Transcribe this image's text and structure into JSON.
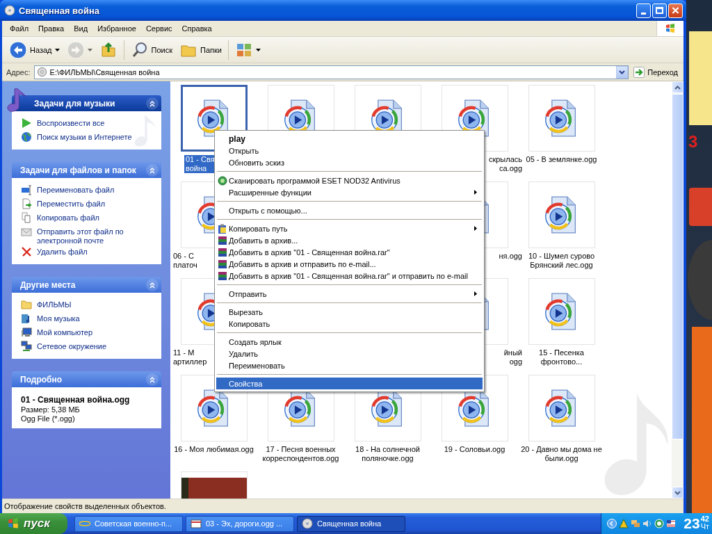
{
  "window": {
    "title": "Священная война"
  },
  "menu_bar": [
    "Файл",
    "Правка",
    "Вид",
    "Избранное",
    "Сервис",
    "Справка"
  ],
  "toolbar": [
    {
      "kind": "back",
      "label": "Назад",
      "disabled": false
    },
    {
      "kind": "forward",
      "disabled": true
    },
    {
      "kind": "up",
      "disabled": false
    },
    {
      "kind": "search",
      "label": "Поиск",
      "disabled": false
    },
    {
      "kind": "folders",
      "label": "Папки",
      "disabled": false
    },
    {
      "kind": "views",
      "disabled": false
    }
  ],
  "address": {
    "label": "Адрес:",
    "value": "E:\\ФИЛЬМЫ\\Священная война",
    "go": "Переход"
  },
  "sidebar": {
    "sections": [
      {
        "kind": "music",
        "title": "Задачи для музыки",
        "items": [
          {
            "label": "Воспроизвести все"
          },
          {
            "label": "Поиск музыки в Интернете"
          }
        ]
      },
      {
        "kind": "tasks",
        "title": "Задачи для файлов и папок",
        "items": [
          {
            "label": "Переименовать файл"
          },
          {
            "label": "Переместить файл"
          },
          {
            "label": "Копировать файл"
          },
          {
            "label": "Отправить этот файл по электронной почте"
          },
          {
            "label": "Удалить файл"
          }
        ]
      },
      {
        "kind": "places",
        "title": "Другие места",
        "items": [
          {
            "label": "ФИЛЬМЫ"
          },
          {
            "label": "Моя музыка"
          },
          {
            "label": "Мой компьютер"
          },
          {
            "label": "Сетевое окружение"
          }
        ]
      },
      {
        "kind": "details",
        "title": "Подробно",
        "name": "01 - Священная война.ogg",
        "lines": [
          "Размер: 5,38 МБ",
          "Ogg File (*.ogg)"
        ]
      }
    ]
  },
  "files": [
    {
      "kind": "audio",
      "label": "01 - Свя\nвойна",
      "selected": true
    },
    {
      "kind": "audio",
      "selected": false
    },
    {
      "kind": "audio",
      "selected": false
    },
    {
      "kind": "audio",
      "label": "скрылась\nса.ogg",
      "selected": false
    },
    {
      "kind": "audio",
      "label": "05 - В землянке.ogg",
      "selected": false
    },
    {
      "kind": "audio",
      "label": "06 - С\nплаточ",
      "selected": false
    },
    {
      "kind": "audio",
      "label": "ня.ogg",
      "selected": false
    },
    {
      "kind": "audio",
      "label": "10 - Шумел сурово\nБрянский лес.ogg",
      "selected": false
    },
    {
      "kind": "audio",
      "label": "11 - М\nартиллер",
      "selected": false
    },
    {
      "kind": "audio",
      "label": "йный\nogg",
      "selected": false
    },
    {
      "kind": "audio",
      "label": "15 - Песенка\nфронтово...",
      "selected": false
    },
    {
      "kind": "audio",
      "label": "16 - Моя любимая.ogg",
      "selected": false
    },
    {
      "kind": "audio",
      "label": "17 - Песня военных\nкорреспондентов.ogg",
      "selected": false
    },
    {
      "kind": "audio",
      "label": "18 - На солнечной\nполяночке.ogg",
      "selected": false
    },
    {
      "kind": "audio",
      "label": "19 - Соловьи.ogg",
      "selected": false
    },
    {
      "kind": "audio",
      "label": "20 - Давно мы дома не\nбыли.ogg",
      "selected": false
    },
    {
      "kind": "image",
      "selected": false
    }
  ],
  "context_menu": {
    "groups": [
      [
        {
          "label": "play",
          "default": true,
          "submenu": false,
          "selected": false
        },
        {
          "label": "Открыть",
          "default": false,
          "submenu": false,
          "selected": false
        },
        {
          "label": "Обновить эскиз",
          "default": false,
          "submenu": false,
          "selected": false
        }
      ],
      [
        {
          "label": "Сканировать программой ESET NOD32 Antivirus",
          "default": false,
          "submenu": false,
          "selected": false
        },
        {
          "label": "Расширенные функции",
          "default": false,
          "submenu": true,
          "selected": false
        }
      ],
      [
        {
          "label": "Открыть с помощью...",
          "default": false,
          "submenu": false,
          "selected": false
        }
      ],
      [
        {
          "label": "Копировать путь",
          "default": false,
          "submenu": true,
          "selected": false
        },
        {
          "label": "Добавить в архив...",
          "default": false,
          "submenu": false,
          "selected": false
        },
        {
          "label": "Добавить в архив \"01 - Священная война.rar\"",
          "default": false,
          "submenu": false,
          "selected": false
        },
        {
          "label": "Добавить в архив и отправить по e-mail...",
          "default": false,
          "submenu": false,
          "selected": false
        },
        {
          "label": "Добавить в архив \"01 - Священная война.rar\" и отправить по e-mail",
          "default": false,
          "submenu": false,
          "selected": false
        }
      ],
      [
        {
          "label": "Отправить",
          "default": false,
          "submenu": true,
          "selected": false
        }
      ],
      [
        {
          "label": "Вырезать",
          "default": false,
          "submenu": false,
          "selected": false
        },
        {
          "label": "Копировать",
          "default": false,
          "submenu": false,
          "selected": false
        }
      ],
      [
        {
          "label": "Создать ярлык",
          "default": false,
          "submenu": false,
          "selected": false
        },
        {
          "label": "Удалить",
          "default": false,
          "submenu": false,
          "selected": false
        },
        {
          "label": "Переименовать",
          "default": false,
          "submenu": false,
          "selected": false
        }
      ],
      [
        {
          "label": "Свойства",
          "default": false,
          "submenu": false,
          "selected": true
        }
      ]
    ]
  },
  "status_bar": "Отображение свойств выделенных объектов.",
  "desktop": {
    "widget_text": "3"
  },
  "taskbar": {
    "start": "пуск",
    "tasks": [
      {
        "label": "Советская военно-п...",
        "selected": false
      },
      {
        "label": "03 - Эх, дороги.ogg ...",
        "selected": false
      },
      {
        "label": "Священная война",
        "selected": true
      }
    ],
    "clock": {
      "hour": "23",
      "minute": "42",
      "day": "Чт"
    }
  }
}
